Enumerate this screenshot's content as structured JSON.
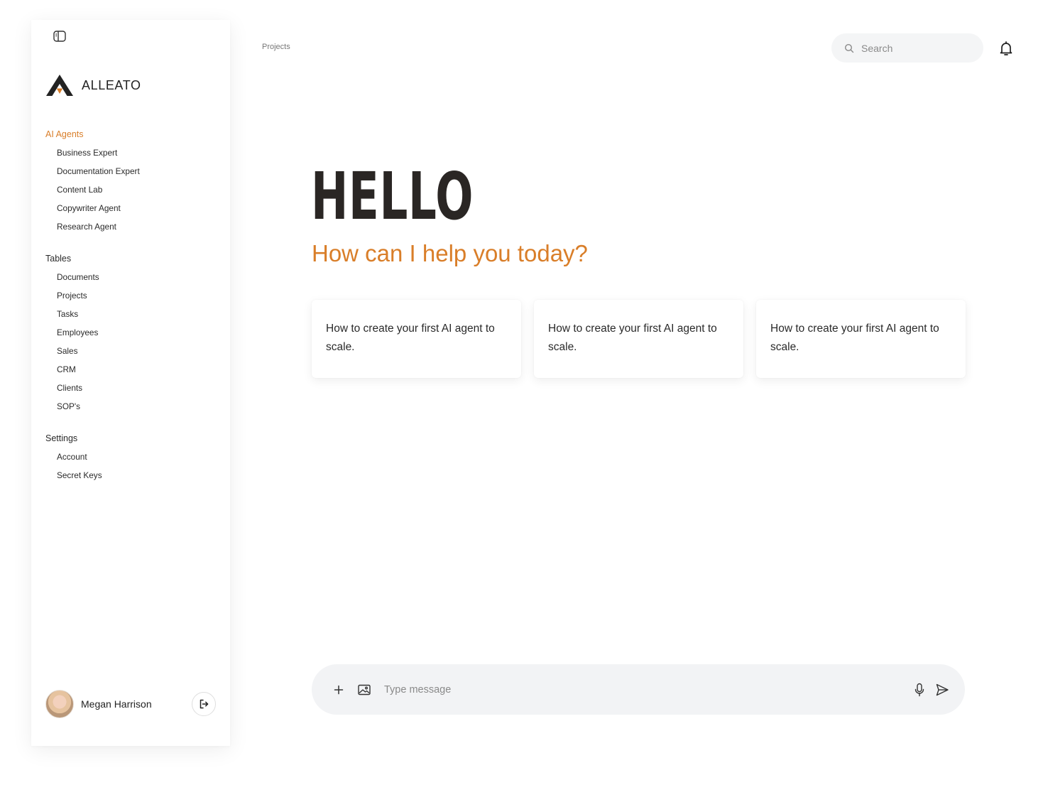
{
  "app": {
    "brand_name": "ALLEATO",
    "brand_colors": {
      "accent": "#d97e29",
      "dark": "#222222"
    }
  },
  "sidebar": {
    "sections": [
      {
        "title": "AI Agents",
        "active": true,
        "items": [
          "Business Expert",
          "Documentation Expert",
          "Content Lab",
          "Copywriter Agent",
          "Research Agent"
        ]
      },
      {
        "title": "Tables",
        "active": false,
        "items": [
          "Documents",
          "Projects",
          "Tasks",
          "Employees",
          "Sales",
          "CRM",
          "Clients",
          "SOP's"
        ]
      },
      {
        "title": "Settings",
        "active": false,
        "items": [
          "Account",
          "Secret Keys"
        ]
      }
    ],
    "user": {
      "name": "Megan Harrison"
    }
  },
  "header": {
    "breadcrumb": "Projects",
    "search_placeholder": "Search"
  },
  "main": {
    "greeting": "HELLO",
    "subtitle": "How can I help you today?",
    "suggestions": [
      "How to create your first AI agent to scale.",
      "How to create your first AI agent to scale.",
      "How to create your first AI agent to scale."
    ]
  },
  "composer": {
    "placeholder": "Type message"
  },
  "icons": {
    "sidebar_toggle": "sidebar-toggle-icon",
    "search": "search-icon",
    "notifications": "bell-icon",
    "logout": "logout-icon",
    "add": "plus-icon",
    "image": "image-icon",
    "voice": "microphone-icon",
    "send": "send-icon"
  }
}
